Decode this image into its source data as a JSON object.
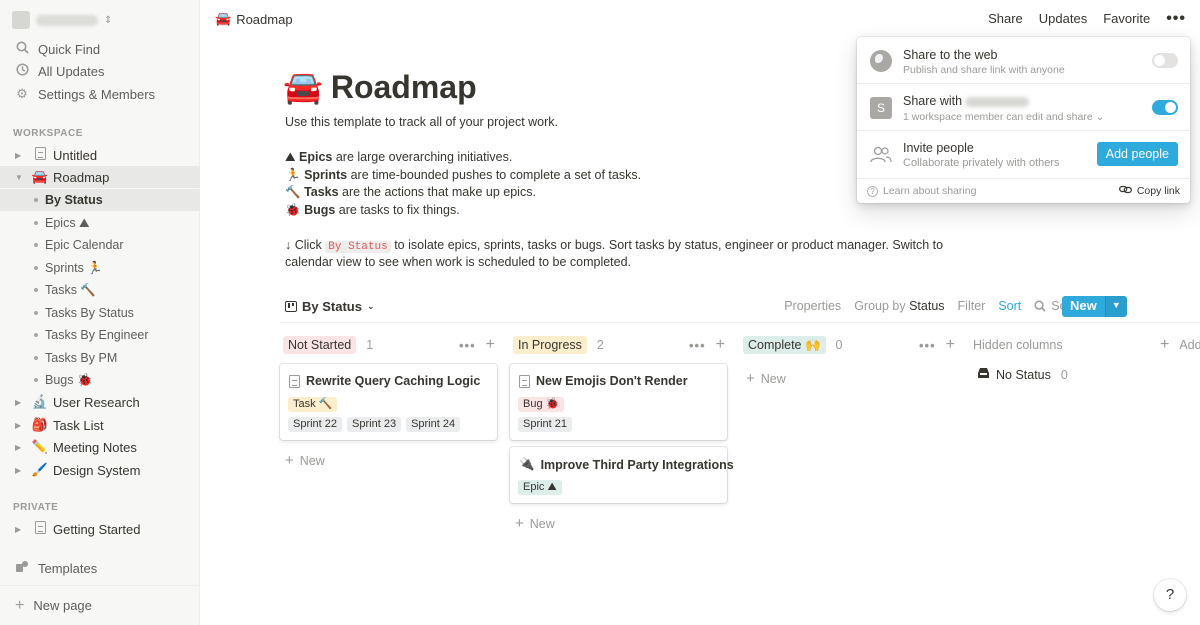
{
  "sidebar": {
    "quick_find": "Quick Find",
    "all_updates": "All Updates",
    "settings": "Settings & Members",
    "workspace_heading": "WORKSPACE",
    "private_heading": "PRIVATE",
    "pages": {
      "untitled": "Untitled",
      "roadmap": "Roadmap",
      "user_research": "User Research",
      "task_list": "Task List",
      "meeting_notes": "Meeting Notes",
      "design_system": "Design System",
      "getting_started": "Getting Started"
    },
    "roadmap_views": [
      "By Status",
      "Epics ⛰",
      "Epic Calendar",
      "Sprints 🏃",
      "Tasks 🔨",
      "Tasks By Status",
      "Tasks By Engineer",
      "Tasks By PM",
      "Bugs 🐞"
    ],
    "templates": "Templates",
    "new_page": "New page"
  },
  "topbar": {
    "breadcrumb": "Roadmap",
    "share": "Share",
    "updates": "Updates",
    "favorite": "Favorite",
    "more": "•••"
  },
  "page": {
    "icon": "🚘",
    "title": "Roadmap",
    "intro": "Use this template to track all of your project work.",
    "bullets": [
      {
        "emoji": "⛰",
        "bold": "Epics",
        "rest": " are large overarching initiatives."
      },
      {
        "emoji": "🏃",
        "bold": "Sprints",
        "rest": " are time-bounded pushes to complete a set of tasks."
      },
      {
        "emoji": "🔨",
        "bold": "Tasks",
        "rest": " are the actions that make up epics."
      },
      {
        "emoji": "🐞",
        "bold": "Bugs",
        "rest": " are tasks to fix things."
      }
    ],
    "click_prefix": "↓ Click",
    "click_code": "By Status",
    "click_rest": "to isolate epics, sprints, tasks or bugs. Sort tasks by status, engineer or product manager. Switch to",
    "click_line2": "calendar view to see when work is scheduled to be completed."
  },
  "view": {
    "name": "By Status",
    "properties": "Properties",
    "group_by": "Group by",
    "group_by_value": "Status",
    "filter": "Filter",
    "sort": "Sort",
    "search": "Search",
    "new": "New"
  },
  "board": {
    "columns": [
      {
        "label": "Not Started",
        "count": "1",
        "color": "#fbe4e4"
      },
      {
        "label": "In Progress",
        "count": "2",
        "color": "#fbeecc"
      },
      {
        "label": "Complete 🙌",
        "count": "0",
        "color": "#ddedea"
      }
    ],
    "cards": [
      {
        "title": "Rewrite Query Caching Logic",
        "type": "Task 🔨",
        "type_color": "#fbeecc",
        "sprints": [
          "Sprint 22",
          "Sprint 23",
          "Sprint 24"
        ]
      },
      {
        "title": "New Emojis Don't Render",
        "type": "Bug 🐞",
        "type_color": "#fbe4e4",
        "sprints": [
          "Sprint 21"
        ]
      },
      {
        "title": "Improve Third Party Integrations",
        "icon": "🔌",
        "type": "Epic ⛰",
        "type_color": "#ddedea"
      }
    ],
    "add_new": "New",
    "hidden_columns": "Hidden columns",
    "add": "Add",
    "no_status": "No Status",
    "no_status_count": "0"
  },
  "share_popover": {
    "web_title": "Share to the web",
    "web_sub": "Publish and share link with anyone",
    "web_enabled": false,
    "with_title": "Share with",
    "with_sub": "1 workspace member can edit and share",
    "with_enabled": true,
    "avatar_letter": "S",
    "invite_title": "Invite people",
    "invite_sub": "Collaborate privately with others",
    "add_people": "Add people",
    "learn": "Learn about sharing",
    "copy_link": "Copy link"
  },
  "colors": {
    "accent": "#2eaadc",
    "sprint_pill": "#ebeced"
  },
  "help": "?"
}
